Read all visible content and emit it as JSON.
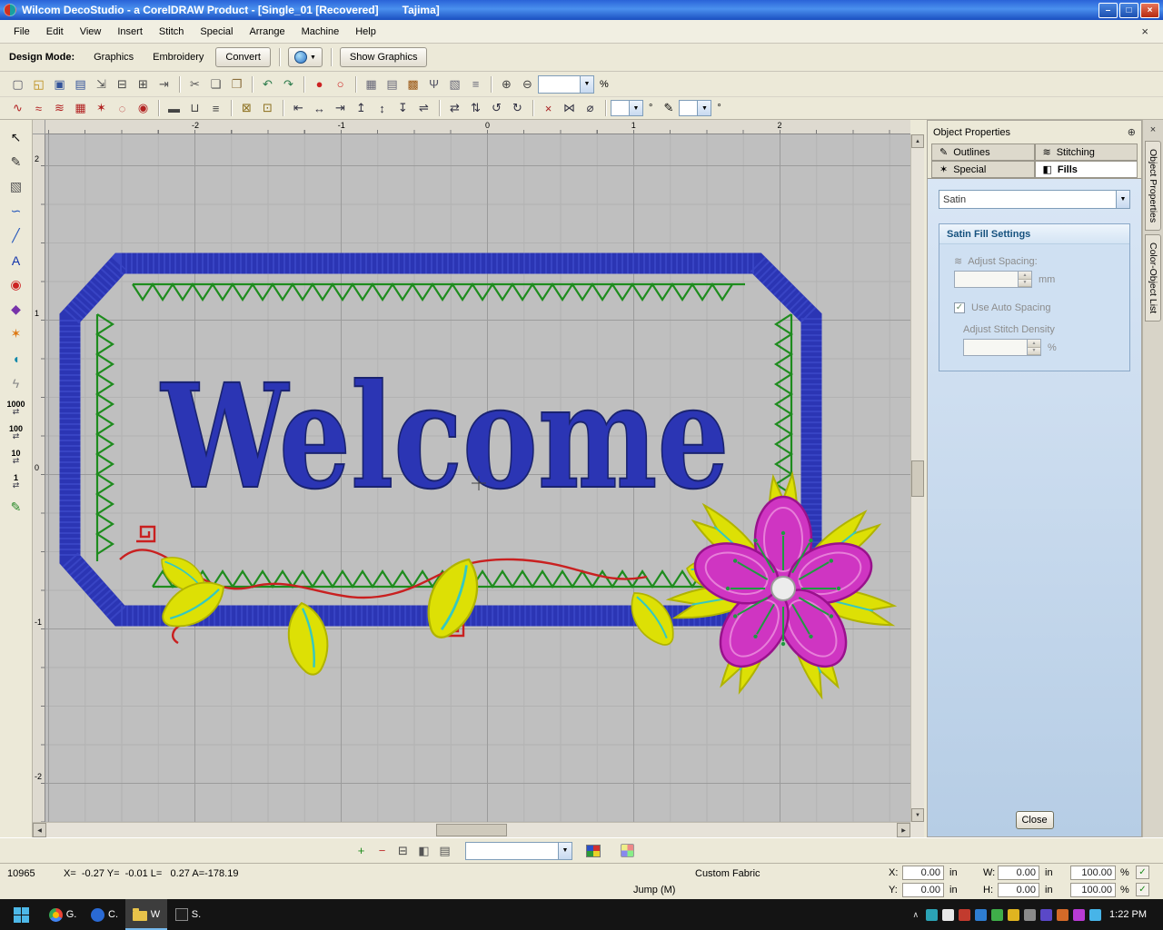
{
  "colors": {
    "frame_blue": "#2b35b4",
    "frame_blue_light": "#4a57d8",
    "leaf_green": "#1e8c1e",
    "stamen_green": "#1f9a40",
    "petal_magenta": "#cf35c2",
    "petal_dark": "#99118c",
    "petal_light": "#e77fd9",
    "leaf_yellow": "#dde005",
    "leaf_yellow_dark": "#b0b300",
    "vine_red": "#c92020",
    "vein_teal": "#35c8c0",
    "text_blue": "#2b35b4"
  },
  "titlebar": {
    "title": "Wilcom DecoStudio - a CorelDRAW Product - [Single_01 [Recovered]",
    "doc": "Tajima]",
    "buttons": {
      "min": "–",
      "max": "□",
      "close": "×"
    }
  },
  "menu": {
    "items": [
      {
        "label": "File"
      },
      {
        "label": "Edit"
      },
      {
        "label": "View"
      },
      {
        "label": "Insert"
      },
      {
        "label": "Stitch"
      },
      {
        "label": "Special"
      },
      {
        "label": "Arrange"
      },
      {
        "label": "Machine"
      },
      {
        "label": "Help"
      }
    ],
    "doc_close": "×"
  },
  "modebar": {
    "label": "Design Mode:",
    "graphics": "Graphics",
    "embroidery": "Embroidery",
    "convert": "Convert",
    "globe_arrow": "▼",
    "show_graphics": "Show Graphics"
  },
  "toolbar_main": {
    "file": [
      {
        "name": "new-design-icon",
        "glyph": "▢",
        "color": "#556"
      },
      {
        "name": "open-design-icon",
        "glyph": "◱",
        "color": "#b8860b"
      },
      {
        "name": "save-design-icon",
        "glyph": "▣",
        "color": "#33539a"
      },
      {
        "name": "save-as-icon",
        "glyph": "▤",
        "color": "#33539a"
      },
      {
        "name": "insert-design-icon",
        "glyph": "⇲",
        "color": "#555"
      },
      {
        "name": "print-icon",
        "glyph": "⊟",
        "color": "#444"
      },
      {
        "name": "print-preview-icon",
        "glyph": "⊞",
        "color": "#444"
      },
      {
        "name": "export-machine-icon",
        "glyph": "⇥",
        "color": "#555"
      }
    ],
    "edit": [
      {
        "name": "cut-icon",
        "glyph": "✂",
        "color": "#555"
      },
      {
        "name": "copy-icon",
        "glyph": "❏",
        "color": "#555"
      },
      {
        "name": "paste-icon",
        "glyph": "❐",
        "color": "#8a6d3b"
      }
    ],
    "history": [
      {
        "name": "undo-icon",
        "glyph": "↶",
        "color": "#2a7a4a"
      },
      {
        "name": "redo-icon",
        "glyph": "↷",
        "color": "#2a7a4a"
      }
    ],
    "digitize": [
      {
        "name": "closed-object-icon",
        "glyph": "●",
        "color": "#cc2222"
      },
      {
        "name": "open-object-icon",
        "glyph": "○",
        "color": "#cc2222"
      }
    ],
    "view": [
      {
        "name": "show-grid-icon",
        "glyph": "▦",
        "color": "#667"
      },
      {
        "name": "stitch-list-icon",
        "glyph": "▤",
        "color": "#667"
      },
      {
        "name": "color-film-icon",
        "glyph": "▩",
        "color": "#995511"
      },
      {
        "name": "branching-icon",
        "glyph": "Ψ",
        "color": "#556"
      },
      {
        "name": "overlap-icon",
        "glyph": "▧",
        "color": "#667"
      },
      {
        "name": "sequence-icon",
        "glyph": "≡",
        "color": "#667"
      }
    ],
    "zoom": [
      {
        "name": "zoom-in-icon",
        "glyph": "⊕",
        "color": "#444"
      },
      {
        "name": "zoom-out-icon",
        "glyph": "⊖",
        "color": "#444"
      }
    ],
    "zoom_value": "",
    "percent": "%"
  },
  "toolbar_stitch": {
    "stitches": [
      {
        "name": "run-stitch-icon",
        "glyph": "∿",
        "color": "#b22222"
      },
      {
        "name": "triple-run-icon",
        "glyph": "≈",
        "color": "#b22222"
      },
      {
        "name": "satin-stitch-icon",
        "glyph": "≋",
        "color": "#b22222"
      },
      {
        "name": "tatami-fill-icon",
        "glyph": "▦",
        "color": "#b22222"
      },
      {
        "name": "motif-fill-icon",
        "glyph": "✶",
        "color": "#b22222"
      },
      {
        "name": "contour-fill-icon",
        "glyph": "◌",
        "color": "#b22222"
      },
      {
        "name": "fusion-fill-icon",
        "glyph": "◉",
        "color": "#b22222"
      }
    ],
    "outline": [
      {
        "name": "outline-icon",
        "glyph": "▬",
        "color": "#444"
      },
      {
        "name": "offset-icon",
        "glyph": "⊔",
        "color": "#444"
      },
      {
        "name": "backstitch-icon",
        "glyph": "≡",
        "color": "#444"
      }
    ],
    "lock": [
      {
        "name": "lock-icon",
        "glyph": "⊠",
        "color": "#8a6d1a"
      },
      {
        "name": "unlock-icon",
        "glyph": "⊡",
        "color": "#8a6d1a"
      }
    ],
    "align": [
      {
        "name": "align-left-icon",
        "glyph": "⇤",
        "color": "#334"
      },
      {
        "name": "align-center-icon",
        "glyph": "↔",
        "color": "#334"
      },
      {
        "name": "align-right-icon",
        "glyph": "⇥",
        "color": "#334"
      },
      {
        "name": "align-top-icon",
        "glyph": "↥",
        "color": "#334"
      },
      {
        "name": "align-middle-icon",
        "glyph": "↕",
        "color": "#334"
      },
      {
        "name": "align-bottom-icon",
        "glyph": "↧",
        "color": "#334"
      },
      {
        "name": "space-evenly-icon",
        "glyph": "⇌",
        "color": "#334"
      }
    ],
    "mirror": [
      {
        "name": "mirror-horizontal-icon",
        "glyph": "⇄",
        "color": "#334"
      },
      {
        "name": "mirror-vertical-icon",
        "glyph": "⇅",
        "color": "#334"
      },
      {
        "name": "rotate-ccw-icon",
        "glyph": "↺",
        "color": "#334"
      },
      {
        "name": "rotate-cw-icon",
        "glyph": "↻",
        "color": "#334"
      }
    ],
    "gap": [
      {
        "name": "delete-stitch-icon",
        "glyph": "×",
        "color": "#aa2222"
      },
      {
        "name": "knife-icon",
        "glyph": "⋈",
        "color": "#334"
      },
      {
        "name": "reset-icon",
        "glyph": "⌀",
        "color": "#334"
      }
    ],
    "angle1": "",
    "angle2": "",
    "deg": "°",
    "pen": "✎"
  },
  "left_tools": {
    "tools": [
      {
        "name": "select-tool",
        "glyph": "↖",
        "color": "#111"
      },
      {
        "name": "reshape-tool",
        "glyph": "✎",
        "color": "#333"
      },
      {
        "name": "box-select-tool",
        "glyph": "▧",
        "color": "#555"
      },
      {
        "name": "curve-tool",
        "glyph": "∽",
        "color": "#2255bb"
      },
      {
        "name": "line-tool",
        "glyph": "╱",
        "color": "#2255bb"
      },
      {
        "name": "lettering-tool",
        "glyph": "A",
        "color": "#1133aa"
      },
      {
        "name": "redwork-tool",
        "glyph": "◉",
        "color": "#cc2222"
      },
      {
        "name": "fill-tool",
        "glyph": "◆",
        "color": "#7733aa"
      },
      {
        "name": "motif-tool",
        "glyph": "✶",
        "color": "#dd7711"
      },
      {
        "name": "applique-tool",
        "glyph": "◖",
        "color": "#1188aa"
      },
      {
        "name": "penetration-tool",
        "glyph": "ϟ",
        "color": "#888"
      }
    ],
    "travel": [
      {
        "name": "travel-1000-tool",
        "num": "1000"
      },
      {
        "name": "travel-100-tool",
        "num": "100"
      },
      {
        "name": "travel-10-tool",
        "num": "10"
      },
      {
        "name": "travel-1-tool",
        "num": "1"
      }
    ],
    "extra": [
      {
        "name": "digitize-run-tool",
        "glyph": "✎",
        "color": "#2a8a2a"
      }
    ],
    "travel_arrows": "⇄"
  },
  "rulers": {
    "h": [
      "-2",
      "-1",
      "0",
      "1",
      "2"
    ],
    "v": [
      "2",
      "1",
      "0",
      "-1",
      "-2"
    ]
  },
  "design": {
    "text": "Welcome"
  },
  "object_properties": {
    "title": "Object Properties",
    "pin": "⊕",
    "tabs": {
      "outlines": "Outlines",
      "stitching": "Stitching",
      "special": "Special",
      "fills": "Fills"
    },
    "tab_icons": {
      "outlines": "✎",
      "stitching": "≋",
      "special": "✶",
      "fills": "◧"
    },
    "fill_type": "Satin",
    "combo_arrow": "▼",
    "section": "Satin Fill Settings",
    "spacing_icon": "≋",
    "adjust_spacing": "Adjust Spacing:",
    "spacing_value": "",
    "mm": "mm",
    "auto_check": "✓",
    "auto_spacing": "Use Auto Spacing",
    "density_label": "Adjust Stitch Density",
    "density_value": "",
    "pct": "%",
    "close": "Close"
  },
  "side_tabs": {
    "close": "×",
    "t1": "Object Properties",
    "t2": "Color-Object List"
  },
  "bottom_toolbar": {
    "icons": [
      {
        "name": "add-color-button",
        "glyph": "+",
        "color": "#1a8a1a"
      },
      {
        "name": "remove-color-button",
        "glyph": "−",
        "color": "#c03030"
      },
      {
        "name": "print-colors-button",
        "glyph": "⊟",
        "color": "#444"
      },
      {
        "name": "background-button",
        "glyph": "◧",
        "color": "#555"
      },
      {
        "name": "color-film-button",
        "glyph": "▤",
        "color": "#555"
      }
    ],
    "select_value": "",
    "combo_arrow": "▼"
  },
  "statusbar": {
    "stitches": "10965",
    "coords": "X=  -0.27 Y=  -0.01 L=   0.27 A=-178.19",
    "fabric": "Custom Fabric",
    "jump": "Jump (M)",
    "xl": "X:",
    "yl": "Y:",
    "wl": "W:",
    "hl": "H:",
    "x": "0.00",
    "y": "0.00",
    "w": "0.00",
    "h": "0.00",
    "unit": "in",
    "sx": "100.00",
    "sy": "100.00",
    "pct": "%",
    "check": "✓"
  },
  "taskbar": {
    "apps": {
      "a1": "G.",
      "a2": "C.",
      "a3": "W",
      "a4": "S."
    },
    "tray": [
      {
        "name": "tray-icon",
        "color": "#2ba3b5"
      },
      {
        "name": "tray-icon",
        "color": "#e8e8e8"
      },
      {
        "name": "tray-icon",
        "color": "#c23b2e"
      },
      {
        "name": "tray-icon",
        "color": "#2e7dd1"
      },
      {
        "name": "tray-icon",
        "color": "#3fae49"
      },
      {
        "name": "tray-icon",
        "color": "#e0b420"
      },
      {
        "name": "tray-icon",
        "color": "#8a8a8a"
      },
      {
        "name": "tray-icon",
        "color": "#5a48c8"
      },
      {
        "name": "tray-icon",
        "color": "#d46a28"
      },
      {
        "name": "tray-icon",
        "color": "#b83bd4"
      },
      {
        "name": "tray-icon",
        "color": "#47b4e8"
      }
    ],
    "expand": "∧",
    "time": "1:22 PM"
  }
}
